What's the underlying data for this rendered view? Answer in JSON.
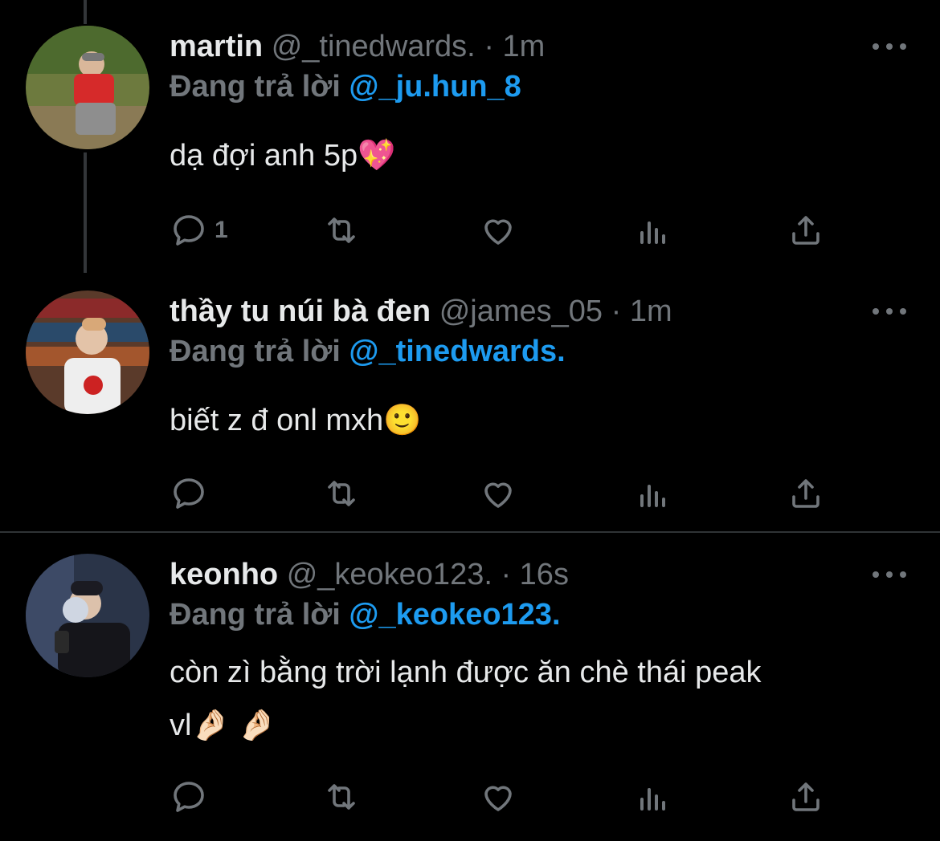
{
  "colors": {
    "background": "#000000",
    "text": "#e7e9ea",
    "muted": "#71767b",
    "mention": "#1d9bf0",
    "divider": "#2f3336"
  },
  "tweets": [
    {
      "display_name": "martin",
      "handle": "@_tinedwards.",
      "separator": "·",
      "time": "1m",
      "replying_prefix": "Đang trả lời",
      "replying_to": "@_ju.hun_8",
      "text": "dạ đợi anh 5p💖",
      "reply_count": "1",
      "avatar_icon": "avatar-photo"
    },
    {
      "display_name": "thầy tu núi bà đen",
      "handle": "@james_05",
      "separator": "·",
      "time": "1m",
      "replying_prefix": "Đang trả lời",
      "replying_to": "@_tinedwards.",
      "text": "biết z đ onl mxh🙂",
      "reply_count": "",
      "avatar_icon": "avatar-photo"
    },
    {
      "display_name": "keonho",
      "handle": "@_keokeo123.",
      "separator": "·",
      "time": "16s",
      "replying_prefix": "Đang trả lời",
      "replying_to": "@_keokeo123.",
      "text_line1": "còn zì bằng trời lạnh được ăn chè thái peak",
      "text_line2": "vl🤌🏻 🤌🏻",
      "reply_count": "",
      "avatar_icon": "avatar-photo"
    }
  ],
  "action_icons": [
    "reply-icon",
    "retweet-icon",
    "like-icon",
    "views-icon",
    "share-icon"
  ]
}
